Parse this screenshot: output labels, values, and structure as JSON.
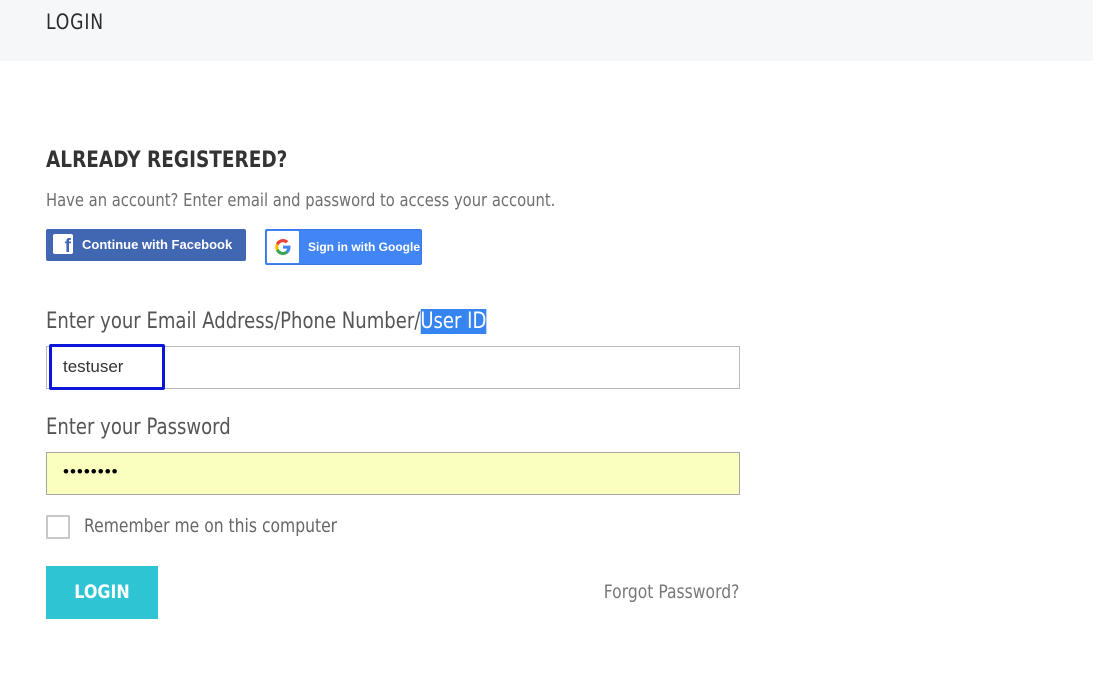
{
  "header": {
    "title": "LOGIN"
  },
  "login_panel": {
    "heading": "ALREADY REGISTERED?",
    "subtext": "Have an account? Enter email and password to access your account.",
    "facebook_button": "Continue with Facebook",
    "google_button": "Sign in with Google"
  },
  "form": {
    "username_label_prefix": "Enter your Email Address/Phone Number/",
    "username_label_highlight": "User ID",
    "username_value": "testuser",
    "password_label": "Enter your Password",
    "password_value": "••••••••",
    "remember_label": "Remember me on this computer",
    "remember_checked": false,
    "login_button": "LOGIN",
    "forgot_link": "Forgot Password?"
  },
  "colors": {
    "facebook_blue": "#4267b2",
    "google_blue": "#4285f4",
    "login_teal": "#2ec4d3",
    "autofill_yellow": "#faffbd",
    "focus_outline": "#0a17d6",
    "selection_highlight": "#3584f0"
  },
  "icons": {
    "facebook": "facebook-icon",
    "google": "google-icon",
    "checkbox": "checkbox-icon"
  }
}
